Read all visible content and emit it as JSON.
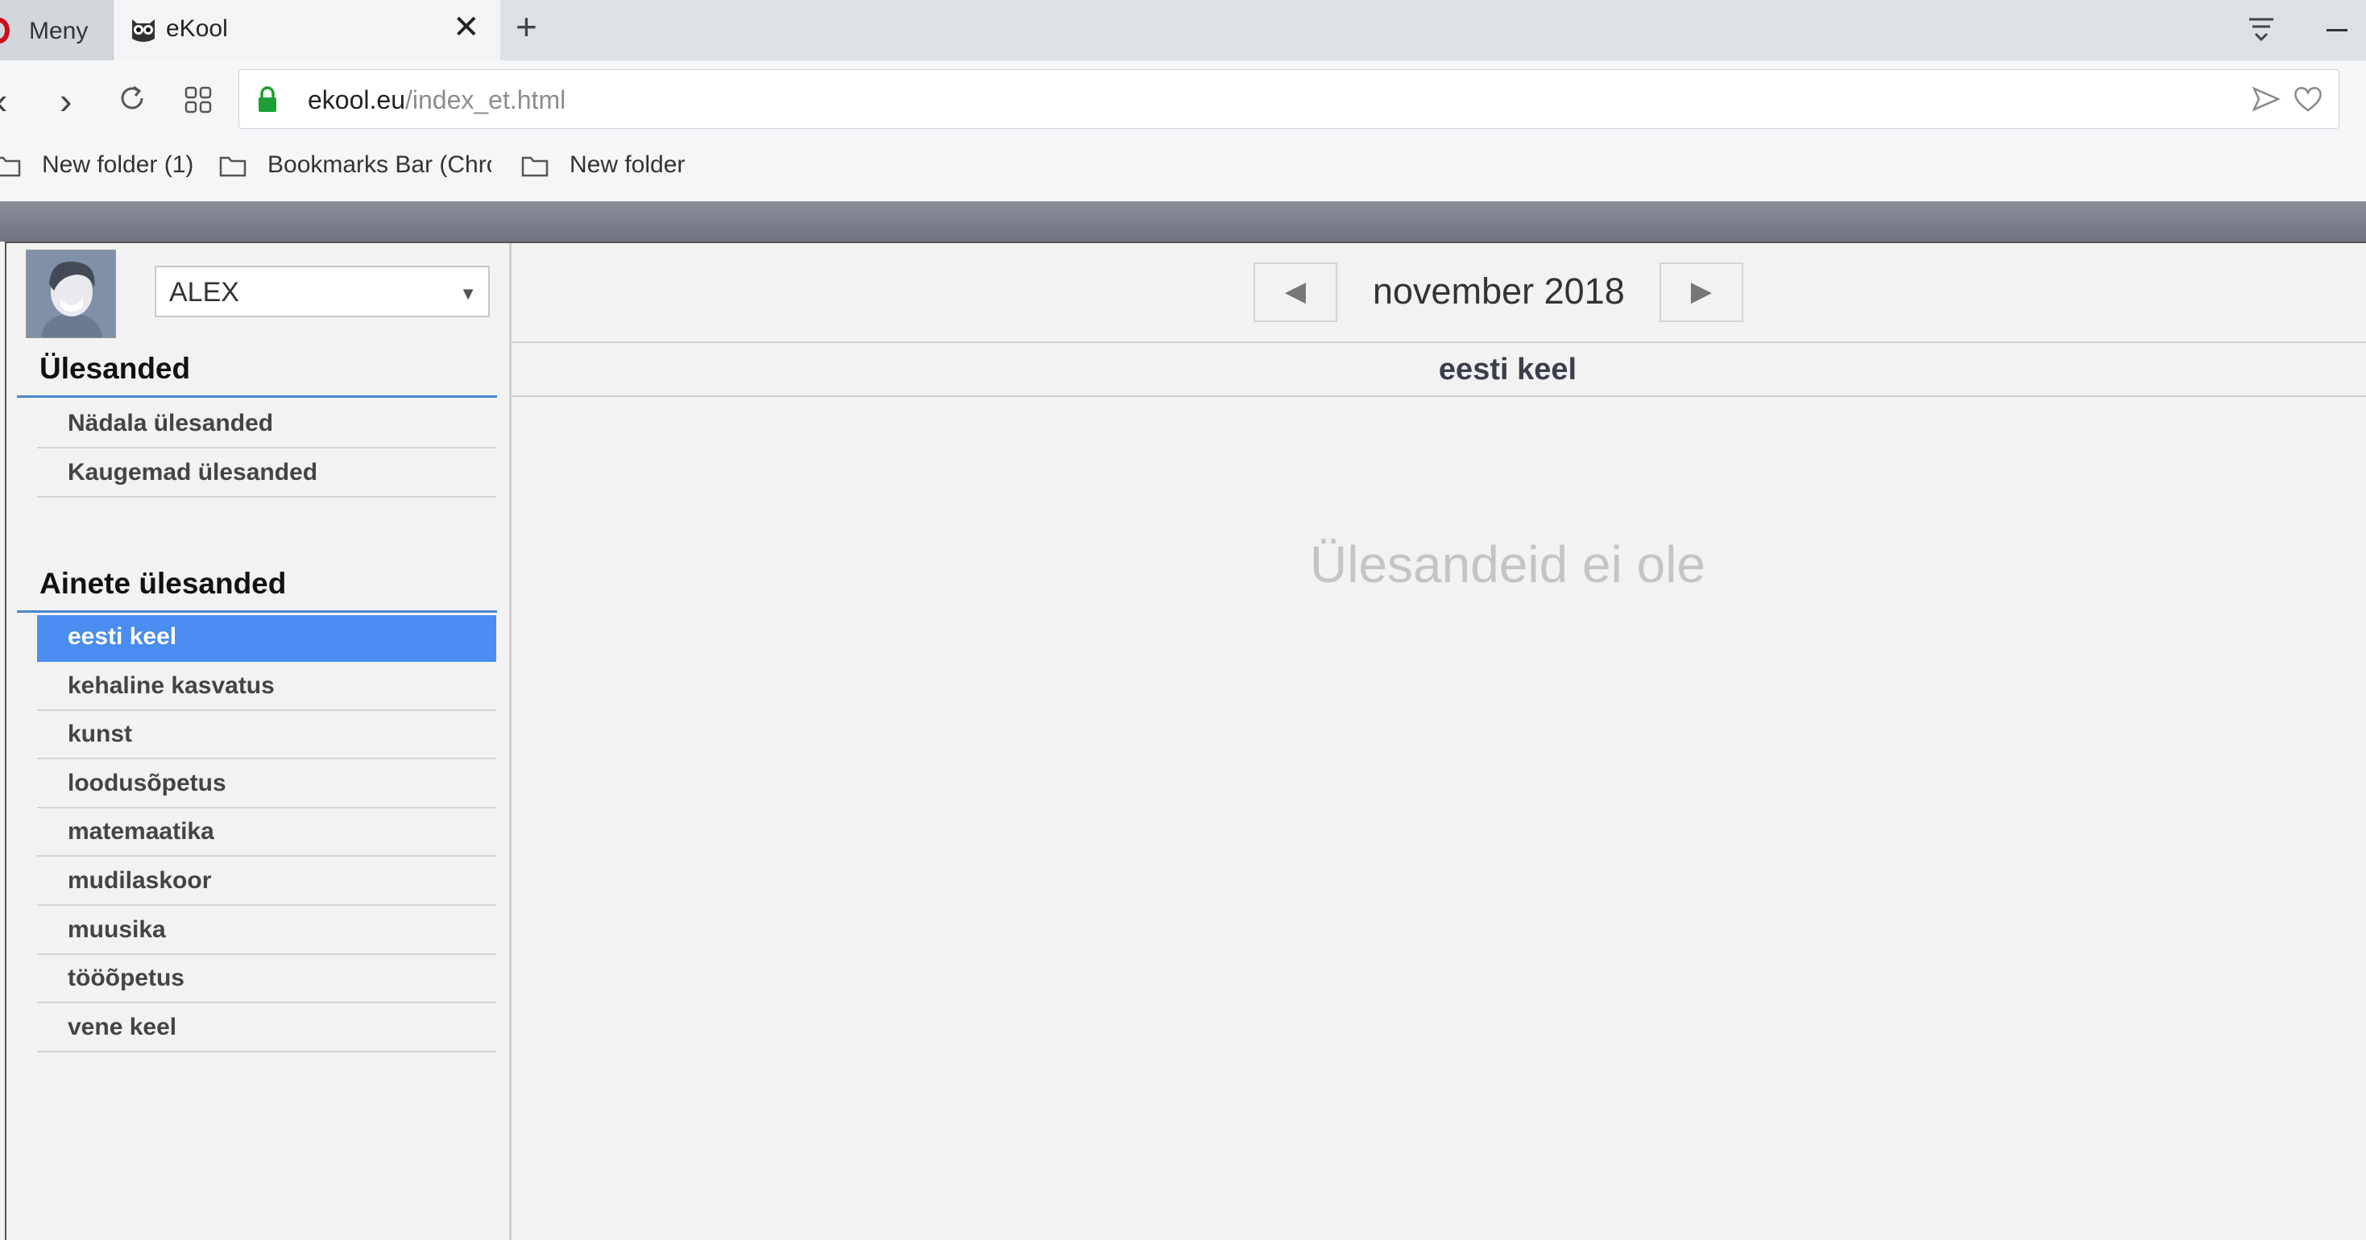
{
  "browser": {
    "menu_label": "Meny",
    "tab_title": "eKool",
    "url_host": "ekool.eu",
    "url_path": "/index_et.html",
    "bookmarks": [
      "New folder (1)",
      "Bookmarks Bar (Chro",
      "New folder"
    ]
  },
  "user": {
    "selected": "ALEX"
  },
  "calendar": {
    "month_label": "november 2018"
  },
  "sidebar": {
    "tasks_title": "Ülesanded",
    "tasks": [
      {
        "label": "Nädala ülesanded"
      },
      {
        "label": "Kaugemad ülesanded"
      }
    ],
    "subjects_title": "Ainete ülesanded",
    "subjects": [
      {
        "label": "eesti keel"
      },
      {
        "label": "kehaline kasvatus"
      },
      {
        "label": "kunst"
      },
      {
        "label": "loodusõpetus"
      },
      {
        "label": "matemaatika"
      },
      {
        "label": "mudilaskoor"
      },
      {
        "label": "muusika"
      },
      {
        "label": "tööõpetus"
      },
      {
        "label": "vene keel"
      }
    ],
    "active_subject": "eesti keel"
  },
  "main": {
    "subject_title": "eesti keel",
    "empty_message": "Ülesandeid ei ole"
  },
  "colors": {
    "accent": "#4a8cf0",
    "section_line": "#4a86d0"
  }
}
